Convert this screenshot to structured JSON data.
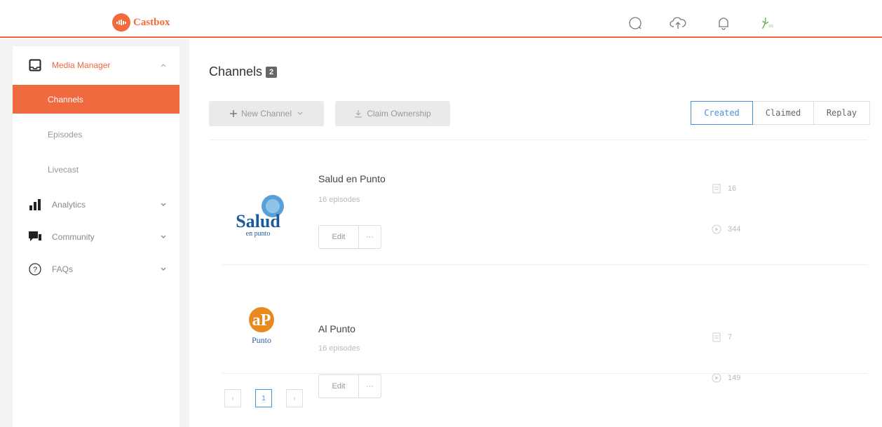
{
  "app": {
    "brand": "Castbox",
    "accent": "#f06a3f"
  },
  "header": {
    "icons": [
      "search-icon",
      "upload-icon",
      "bell-icon",
      "avatar"
    ]
  },
  "sidebar": {
    "sections": [
      {
        "label": "Media Manager",
        "icon": "inbox-icon",
        "expanded": true,
        "items": [
          {
            "label": "Channels",
            "active": true
          },
          {
            "label": "Episodes",
            "active": false
          },
          {
            "label": "Livecast",
            "active": false
          }
        ]
      },
      {
        "label": "Analytics",
        "icon": "bar-chart-icon",
        "expanded": false
      },
      {
        "label": "Community",
        "icon": "chat-icon",
        "expanded": false
      },
      {
        "label": "FAQs",
        "icon": "question-icon",
        "expanded": false
      }
    ]
  },
  "main": {
    "title": "Channels",
    "count": "2",
    "new_channel_label": "New Channel",
    "claim_label": "Claim Ownership",
    "filters": [
      {
        "label": "Created",
        "active": true
      },
      {
        "label": "Claimed",
        "active": false
      },
      {
        "label": "Replay",
        "active": false
      }
    ],
    "channels": [
      {
        "name": "Salud en Punto",
        "episodes": "16 episodes",
        "edit": "Edit",
        "more": "···",
        "stat1": "16",
        "stat2": "344",
        "logo": {
          "top": "Salud",
          "bottom": "en punto"
        }
      },
      {
        "name": "Al Punto",
        "episodes": "16 episodes",
        "edit": "Edit",
        "more": "···",
        "stat1": "7",
        "stat2": "149",
        "logo": {
          "top": "aP",
          "bottom": "Punto"
        }
      }
    ],
    "pagination": {
      "prev": "‹",
      "page": "1",
      "next": "›"
    }
  }
}
